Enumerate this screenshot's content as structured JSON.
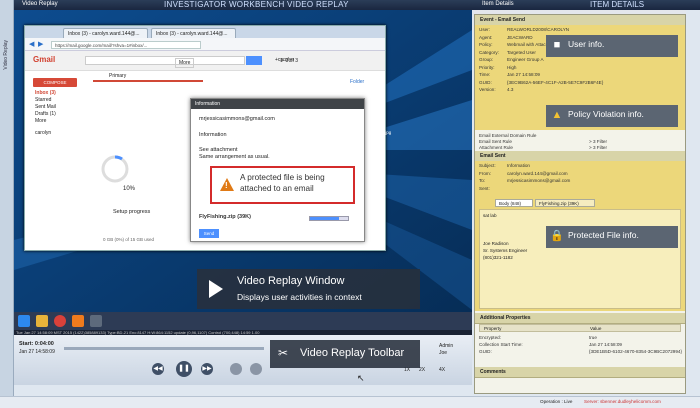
{
  "app": {
    "left_strip_label": "Video Replay",
    "top_left_label": "Video Replay",
    "top_center_title": "INVESTIGATOR WORKBENCH   VIDEO REPLAY"
  },
  "browser": {
    "tab1": "Inbox (3) - carolyn.ward.144@...",
    "tab2": "Inbox (3) - carolyn.ward.144@...",
    "url": "https://mail.google.com/mail/?shva=1#inbox/...",
    "gmail_label": "Gmail",
    "compose_label": "COMPOSE",
    "primary_tab": "Primary",
    "more_label": "More",
    "page_count": "1–3 of 3",
    "user_label": "+carolyn",
    "folder_label": "Folder",
    "nav": [
      "Inbox (3)",
      "Starred",
      "Sent Mail",
      "Drafts (1)",
      "More"
    ],
    "chat_user": "carolyn",
    "setup_progress": "Setup progress",
    "setup_percent": "10%",
    "storage_text": "0 GB (0%) of 15 GB used",
    "desktop_file": "TheBearCatch.jpg",
    "status_hint": "Composed(user) Video Recorded"
  },
  "info_window": {
    "header": "Information",
    "email": "mrjessicasimmons@gmail.com",
    "section": "Information",
    "body1": "See attachment",
    "body2": "Same arrangement as usual.",
    "attachment": "FlyFishing.zip (39K)",
    "send_label": "Send"
  },
  "alert": {
    "text": "A protected file is being attached to an email"
  },
  "overlays": {
    "video_window_title": "Video Replay Window",
    "video_window_sub": "Displays user activities in context",
    "toolbar_title": "Video Replay Toolbar"
  },
  "toolbar": {
    "timeline": "Tue Jan 27 14:58:09 MST 2015 (1422)385889133) Type:BD-21 Enc:8147 H:W:864:1152 update (0,96,1107) Control (700,448) 14:59 1.00",
    "time_label": "Start: 0:04:00",
    "date_label": "Jan 27 14:58:09",
    "user_admin": "Admin",
    "user_joe": "Joe",
    "speed_label": "4X",
    "speed_opt1": "1X",
    "speed_opt2": "2X"
  },
  "right_panel": {
    "title": "Item Details",
    "title_center": "ITEM DETAILS",
    "event_header": "Event - Email Send",
    "event_fields": [
      {
        "k": "User:",
        "v": "REALWORLD2008\\CAROLYN"
      },
      {
        "k": "Agent:",
        "v": "JEACWARD"
      },
      {
        "k": "Policy:",
        "v": "Webmail with Attachment"
      },
      {
        "k": "Category:",
        "v": "Targeted User"
      },
      {
        "k": "Group:",
        "v": "Engineer Group A"
      },
      {
        "k": "Priority:",
        "v": "High"
      },
      {
        "k": "Time:",
        "v": "Jan 27 14:58:09"
      },
      {
        "k": "GUID:",
        "v": "{3EC9B62A-56EF-4C1F-A2B-5E7C9F2B6F4E}"
      },
      {
        "k": "Version:",
        "v": "4.3"
      }
    ],
    "filter_rows": [
      {
        "k": "Email External Domain Rule",
        "v": ""
      },
      {
        "k": "Email Sent Rule",
        "v": "> 3   Filter"
      },
      {
        "k": "Attachment Rule",
        "v": "> 3   Filter"
      }
    ],
    "email_header": "Email Sent",
    "email_fields": [
      {
        "k": "Subject:",
        "v": "Information"
      },
      {
        "k": "From:",
        "v": "carolyn.ward.144@gmail.com"
      },
      {
        "k": "To:",
        "v": "mrjessicasimmons@gmail.com"
      },
      {
        "k": "Sent:",
        "v": ""
      }
    ],
    "email_tab_body": "Body (848)",
    "email_tab_att": "FlyFishing.zip (39K)",
    "email_body_lines": [
      "sat lab",
      "",
      "",
      "",
      "Joe Radison",
      "Sr. Systems Engineer",
      "(801)321-1182"
    ],
    "additional_header": "Additional Properties",
    "prop_cols": [
      "Property",
      "Value"
    ],
    "props": [
      {
        "k": "Encrypted:",
        "v": "true"
      },
      {
        "k": "Collection Start Time:",
        "v": "Jan 27 14:58:09"
      },
      {
        "k": "GUID:",
        "v": "{3DE1B5D-6102-4670-8354-3C9BC2072994}"
      }
    ],
    "comments_header": "Comments",
    "label_user": "User info.",
    "label_policy": "Policy Violation info.",
    "label_file": "Protected File info."
  },
  "status_bar": {
    "operation": "Operation : Live",
    "server": "Server: sbenner.dudleyhelicomm.com"
  },
  "colors": {
    "alert_border": "#d42b2b",
    "warning": "#e07a16",
    "highlight_yellow": "#ecd77a",
    "label_bg": "#5b6572"
  }
}
